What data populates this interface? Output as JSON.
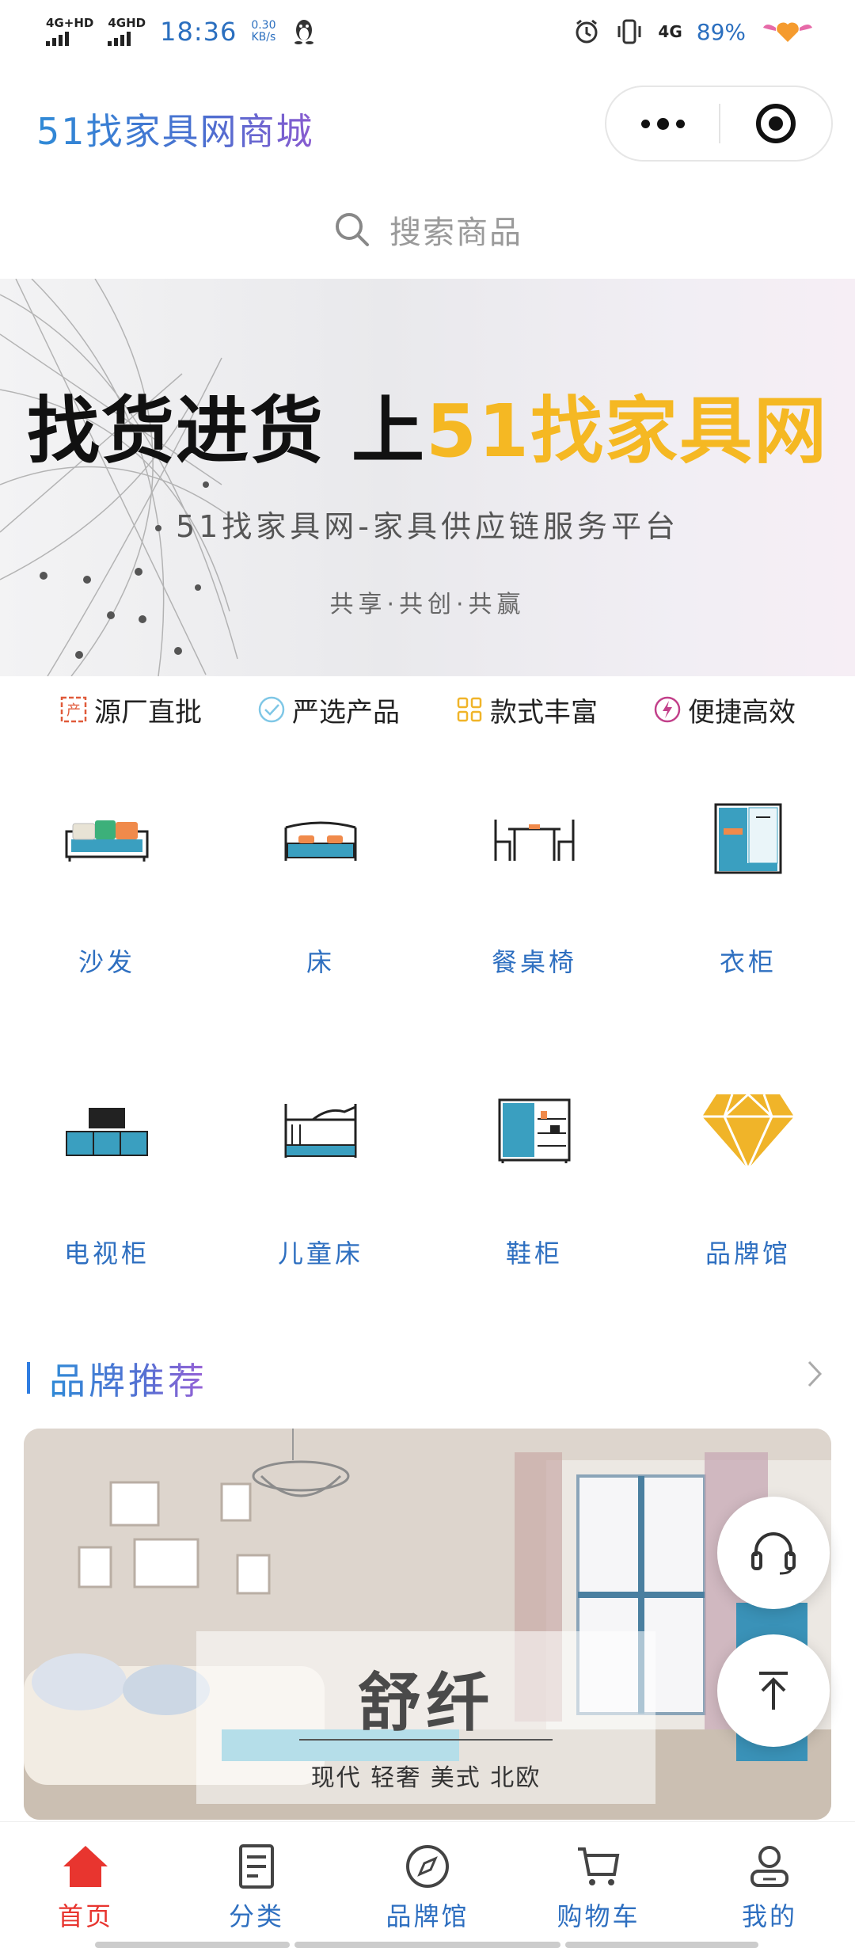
{
  "status_bar": {
    "signal1_label": "4G+HD",
    "signal2_label": "4GHD",
    "time": "18:36",
    "speed_value": "0.30",
    "speed_unit": "KB/s",
    "network_label": "4G",
    "battery": "89%"
  },
  "header": {
    "title": "51找家具网商城"
  },
  "search": {
    "placeholder": "搜索商品"
  },
  "banner": {
    "title_main": "找货进货 上",
    "title_highlight": "51找家具网",
    "subtitle": "51找家具网-家具供应链服务平台",
    "tagline": "共享·共创·共赢",
    "highlight_color": "#f5b823"
  },
  "features": [
    {
      "icon": "factory-icon",
      "label": "源厂直批"
    },
    {
      "icon": "check-circle-icon",
      "label": "严选产品"
    },
    {
      "icon": "grid-icon",
      "label": "款式丰富"
    },
    {
      "icon": "lightning-icon",
      "label": "便捷高效"
    }
  ],
  "categories": [
    {
      "icon": "sofa-icon",
      "label": "沙发"
    },
    {
      "icon": "bed-icon",
      "label": "床"
    },
    {
      "icon": "dining-set-icon",
      "label": "餐桌椅"
    },
    {
      "icon": "wardrobe-icon",
      "label": "衣柜"
    },
    {
      "icon": "tv-cabinet-icon",
      "label": "电视柜"
    },
    {
      "icon": "bunk-bed-icon",
      "label": "儿童床"
    },
    {
      "icon": "shoe-cabinet-icon",
      "label": "鞋柜"
    },
    {
      "icon": "diamond-icon",
      "label": "品牌馆"
    }
  ],
  "brand_section": {
    "title": "品牌推荐",
    "card": {
      "name": "舒纤",
      "description": "现代 轻奢 美式 北欧"
    }
  },
  "floating": {
    "service_icon": "headset-icon",
    "top_icon": "back-to-top-icon"
  },
  "tabbar": [
    {
      "icon": "home-icon",
      "label": "首页",
      "active": true
    },
    {
      "icon": "category-icon",
      "label": "分类",
      "active": false
    },
    {
      "icon": "compass-icon",
      "label": "品牌馆",
      "active": false
    },
    {
      "icon": "cart-icon",
      "label": "购物车",
      "active": false
    },
    {
      "icon": "user-icon",
      "label": "我的",
      "active": false
    }
  ],
  "colors": {
    "accent_blue": "#2e6fc0",
    "active_red": "#e8352f",
    "teal": "#3a9fc0",
    "orange": "#f08a4b",
    "gold": "#f0b429"
  }
}
